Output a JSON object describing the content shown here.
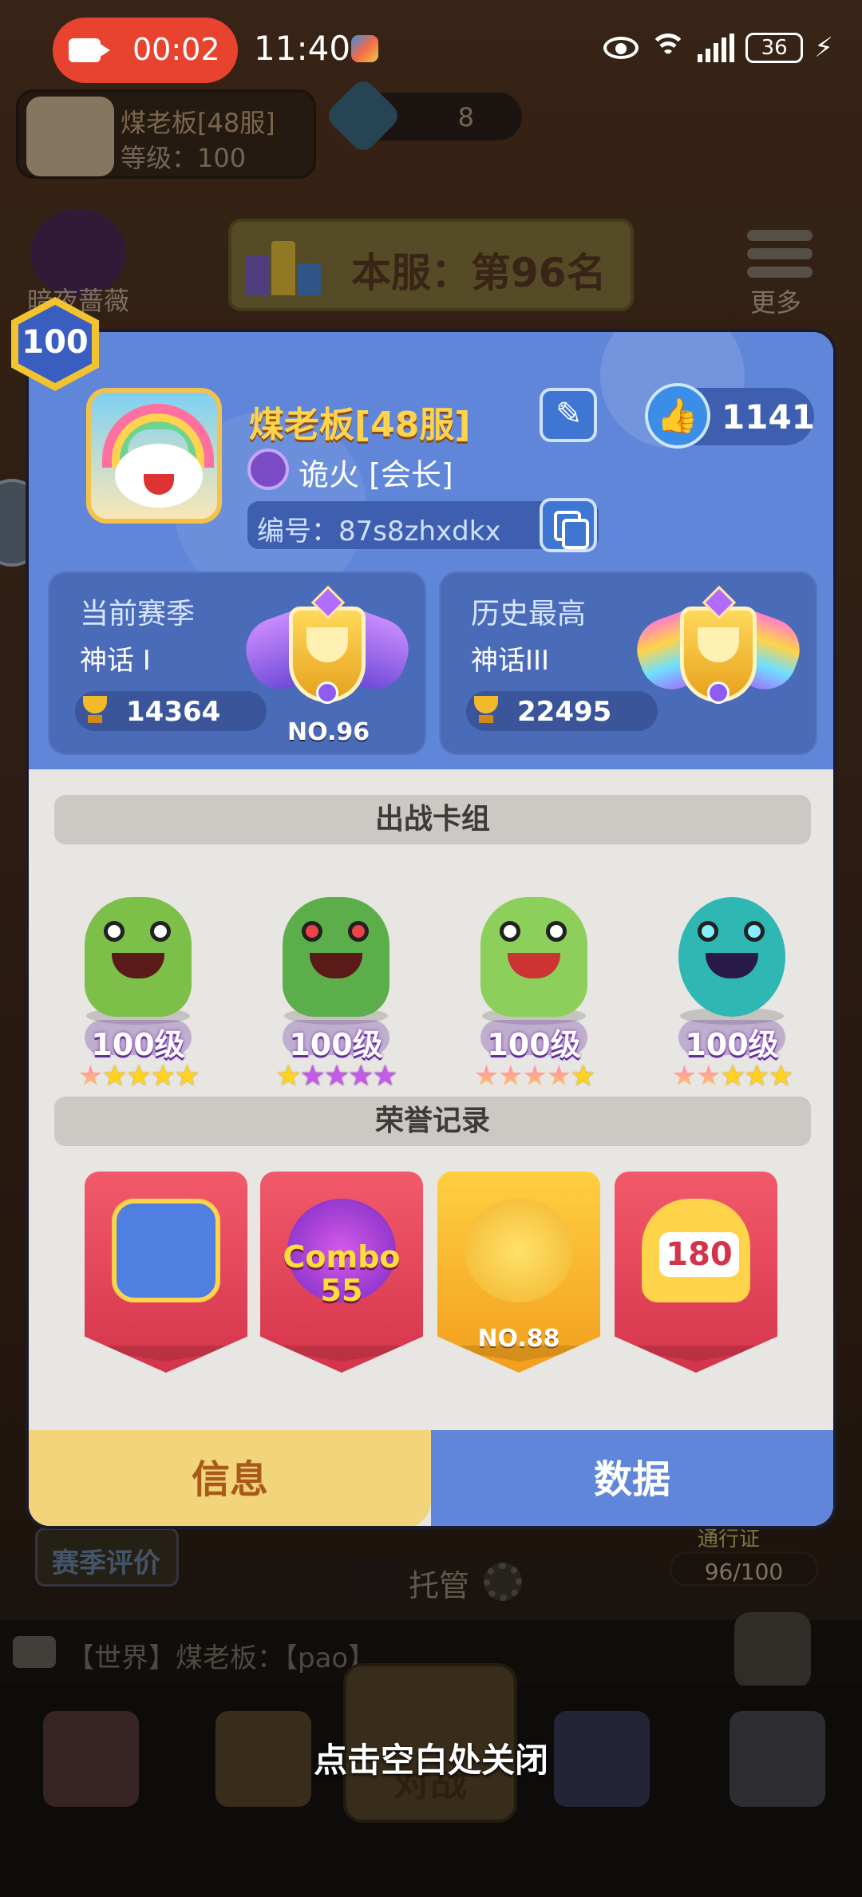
{
  "status_bar": {
    "recording_time": "00:02",
    "clock": "11:40",
    "battery": "36"
  },
  "background": {
    "profile_name": "煤老板[48服]",
    "profile_level": "等级：100",
    "gem_count": "8",
    "night_rose_label": "暗夜蔷薇",
    "server_rank": "本服：第96名",
    "more_label": "更多",
    "season_eval": "赛季评价",
    "pass_label": "通行证",
    "pass_progress": "96/100",
    "auto_label": "托管",
    "chat_message": "【世界】煤老板：【pao】...",
    "battle_label": "对战",
    "close_hint": "点击空白处关闭"
  },
  "profile": {
    "level": "100",
    "name": "煤老板[48服]",
    "guild": "诡火 [会长]",
    "id_text": "编号：87s8zhxdkx",
    "likes": "1141"
  },
  "seasons": {
    "current": {
      "title": "当前赛季",
      "tier": "神话 I",
      "trophies": "14364",
      "rank_no": "NO.96"
    },
    "best": {
      "title": "历史最高",
      "tier": "神话III",
      "trophies": "22495"
    }
  },
  "deck": {
    "title": "出战卡组",
    "cards": [
      {
        "level": "100级",
        "stars": [
          "m",
          "y",
          "y",
          "y",
          "y"
        ]
      },
      {
        "level": "100级",
        "stars": [
          "y",
          "p",
          "p",
          "p",
          "p"
        ]
      },
      {
        "level": "100级",
        "stars": [
          "m",
          "m",
          "m",
          "m",
          "y"
        ]
      },
      {
        "level": "100级",
        "stars": [
          "m",
          "m",
          "y",
          "y",
          "y"
        ]
      }
    ]
  },
  "honors": {
    "title": "荣誉记录",
    "combo_text": "Combo",
    "combo_num": "55",
    "gold_rank": "NO.88",
    "heart_num": "180"
  },
  "tabs": {
    "info": "信息",
    "data": "数据"
  },
  "colors": {
    "panel_blue": "#5f86d8",
    "tab_active": "#f2d47a",
    "name_gold": "#ffd34a"
  }
}
